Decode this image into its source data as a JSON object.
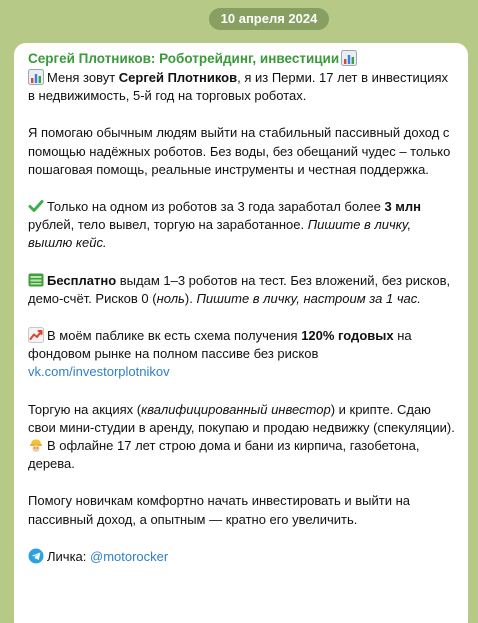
{
  "date_label": "10 апреля 2024",
  "sender": {
    "name": "Сергей Плотников: Роботрейдинг, инвестиции"
  },
  "message": {
    "p1": {
      "pre": "Меня зовут ",
      "bold": "Сергей Плотников",
      "post": ", я из Перми. 17 лет в инвестициях в недвижимость, 5-й год на торговых роботах."
    },
    "p2": "Я помогаю обычным людям выйти на стабильный пассивный доход с помощью надёжных роботов. Без воды, без обещаний чудес – только пошаговая помощь, реальные инструменты и честная поддержка.",
    "p3": {
      "pre": "Только на одном из роботов за 3 года заработал более ",
      "bold": "3 млн",
      "mid": " рублей, тело вывел, торгую на заработанное. ",
      "italic": "Пишите в личку, вышлю кейс."
    },
    "p4": {
      "bold": "Бесплатно",
      "pre": " выдам 1–3 роботов на тест. Без вложений, без рисков, демо-счёт. Рисков 0 (",
      "italic_paren": "ноль",
      "post": "). ",
      "italic": "Пишите в личку, настроим за 1 час."
    },
    "p5": {
      "pre": "В моём паблике вк есть схема получения ",
      "bold": "120% годовых",
      "post": " на фондовом рынке на полном пассиве без рисков",
      "link": "vk.com/investorplotnikov"
    },
    "p6": {
      "pre": "Торгую на акциях (",
      "italic": "квалифицированный инвестор",
      "post": ") и крипте. Сдаю свои мини-студии в аренду, покупаю и продаю недвижку (спекуляции).",
      "line2": "В офлайне 17 лет строю дома и бани из кирпича, газобетона, дерева."
    },
    "p7": "Помогу новичкам комфортно начать инвестировать и выйти на пассивный доход, а опытным — кратно его увеличить.",
    "contact": {
      "label": "Личка: ",
      "handle": "@motorocker"
    }
  },
  "icons": {
    "chart": "chart-icon",
    "check": "check-mark-icon",
    "free": "free-badge-icon",
    "trend": "trending-up-icon",
    "builder": "construction-worker-icon",
    "telegram": "telegram-icon"
  },
  "colors": {
    "background": "#b7c987",
    "sender_name": "#3a9a3a",
    "link": "#2f7fc8",
    "bubble": "#ffffff"
  }
}
